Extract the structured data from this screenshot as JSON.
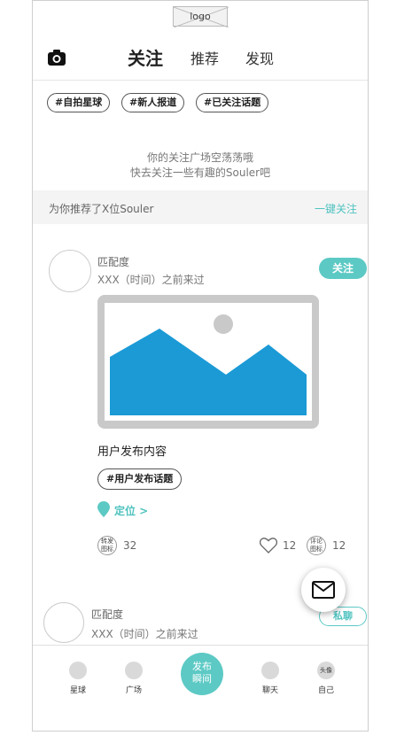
{
  "header": {
    "logo_text": "logo",
    "tabs": [
      {
        "label": "关注",
        "active": true
      },
      {
        "label": "推荐",
        "active": false
      },
      {
        "label": "发现",
        "active": false
      }
    ]
  },
  "followed_topics": [
    "#自拍星球",
    "#新人报道",
    "#已关注话题"
  ],
  "empty_state": {
    "line1": "你的关注广场空荡荡哦",
    "line2": "快去关注一些有趣的Souler吧"
  },
  "recommend_bar": {
    "text": "为你推荐了X位Souler",
    "action": "一键关注"
  },
  "post": {
    "username": "匹配度",
    "time": "XXX（时间）之前来过",
    "follow_label": "关注",
    "content": "用户发布内容",
    "topic": "#用户发布话题",
    "location": "定位 >",
    "repost_icon_text": "转发图标",
    "repost_count": "32",
    "like_count": "12",
    "comment_icon_text": "评论图标",
    "comment_count": "12"
  },
  "post2": {
    "username": "匹配度",
    "time": "XXX（时间）之前来过",
    "chat_label": "私聊"
  },
  "nav": {
    "items": [
      {
        "label": "星球"
      },
      {
        "label": "广场"
      },
      {
        "label": "聊天"
      },
      {
        "label": "自己",
        "icon_text": "头像"
      }
    ],
    "publish_line1": "发布",
    "publish_line2": "瞬间"
  },
  "colors": {
    "accent": "#5cc9c4",
    "image_blue": "#1b9ad6"
  }
}
